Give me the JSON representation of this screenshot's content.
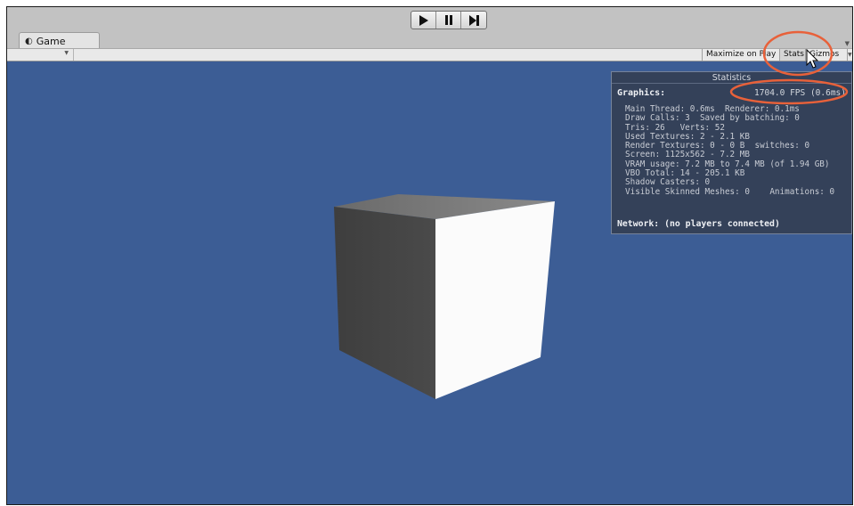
{
  "colors": {
    "viewport_bg": "#3c5d95",
    "stats_panel_bg": "#343f54",
    "annotation_highlight": "#e8613a"
  },
  "play_controls": {
    "play_icon": "play-icon",
    "pause_icon": "pause-icon",
    "step_icon": "step-forward-icon"
  },
  "tab": {
    "label": "Game",
    "icon": "pacman-game-icon"
  },
  "toolbar": {
    "maximize_on_play": "Maximize on Play",
    "stats": "Stats",
    "gizmos": "Gizmos"
  },
  "stats": {
    "title": "Statistics",
    "graphics_label": "Graphics:",
    "fps": "1704.0 FPS (0.6ms)",
    "lines": [
      "Main Thread: 0.6ms  Renderer: 0.1ms",
      "Draw Calls: 3  Saved by batching: 0",
      "Tris: 26   Verts: 52",
      "Used Textures: 2 - 2.1 KB",
      "Render Textures: 0 - 0 B  switches: 0",
      "Screen: 1125x562 - 7.2 MB",
      "VRAM usage: 7.2 MB to 7.4 MB (of 1.94 GB)",
      "VBO Total: 14 - 205.1 KB",
      "Shadow Casters: 0",
      "Visible Skinned Meshes: 0    Animations: 0"
    ],
    "network": "Network: (no players connected)"
  }
}
